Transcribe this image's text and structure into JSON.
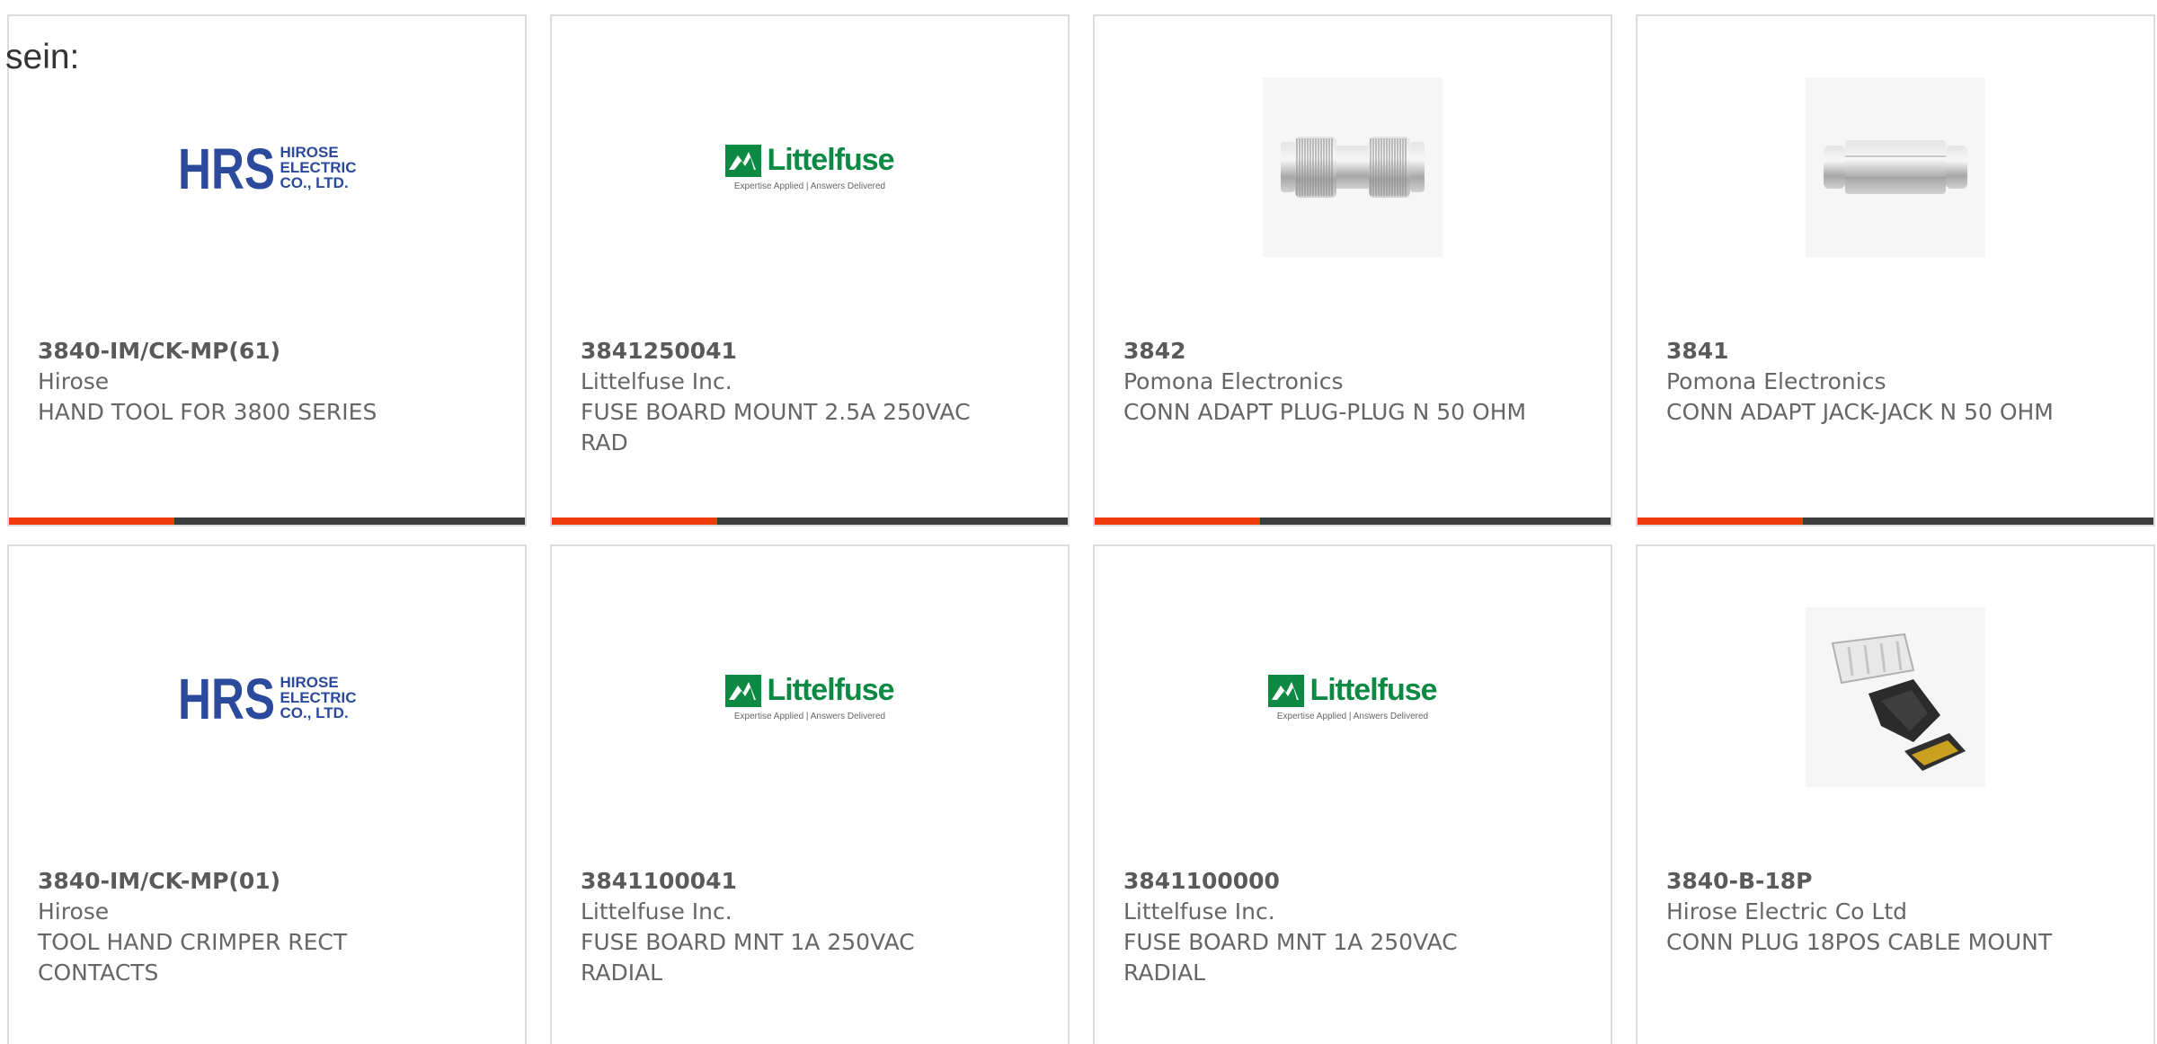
{
  "intro_text": "sein:",
  "colors": {
    "accent": "#ee3b0c",
    "bar": "#3b3b3b",
    "hrs_blue": "#2b4a9b",
    "littelfuse_green": "#0c8a44"
  },
  "products": [
    {
      "part_number": "3840-IM/CK-MP(61)",
      "manufacturer": "Hirose",
      "description": "HAND TOOL FOR 3800 SERIES",
      "image": "hrs-logo",
      "logo_lines": [
        "HIROSE",
        "ELECTRIC",
        "CO., LTD."
      ]
    },
    {
      "part_number": "3841250041",
      "manufacturer": "Littelfuse Inc.",
      "description": "FUSE BOARD MOUNT 2.5A 250VAC RAD",
      "image": "littelfuse-logo",
      "logo_word": "Littelfuse",
      "logo_tagline": "Expertise Applied | Answers Delivered"
    },
    {
      "part_number": "3842",
      "manufacturer": "Pomona Electronics",
      "description": "CONN ADAPT PLUG-PLUG N 50 OHM",
      "image": "plug-plug-adapter"
    },
    {
      "part_number": "3841",
      "manufacturer": "Pomona Electronics",
      "description": "CONN ADAPT JACK-JACK N 50 OHM",
      "image": "jack-jack-adapter"
    },
    {
      "part_number": "3840-IM/CK-MP(01)",
      "manufacturer": "Hirose",
      "description": "TOOL HAND CRIMPER RECT CONTACTS",
      "image": "hrs-logo",
      "logo_lines": [
        "HIROSE",
        "ELECTRIC",
        "CO., LTD."
      ]
    },
    {
      "part_number": "3841100041",
      "manufacturer": "Littelfuse Inc.",
      "description": "FUSE BOARD MNT 1A 250VAC RADIAL",
      "image": "littelfuse-logo",
      "logo_word": "Littelfuse",
      "logo_tagline": "Expertise Applied | Answers Delivered"
    },
    {
      "part_number": "3841100000",
      "manufacturer": "Littelfuse Inc.",
      "description": "FUSE BOARD MNT 1A 250VAC RADIAL",
      "image": "littelfuse-logo",
      "logo_word": "Littelfuse",
      "logo_tagline": "Expertise Applied | Answers Delivered"
    },
    {
      "part_number": "3840-B-18P",
      "manufacturer": "Hirose Electric Co Ltd",
      "description": "CONN PLUG 18POS CABLE MOUNT",
      "image": "cable-plug-connector"
    }
  ]
}
